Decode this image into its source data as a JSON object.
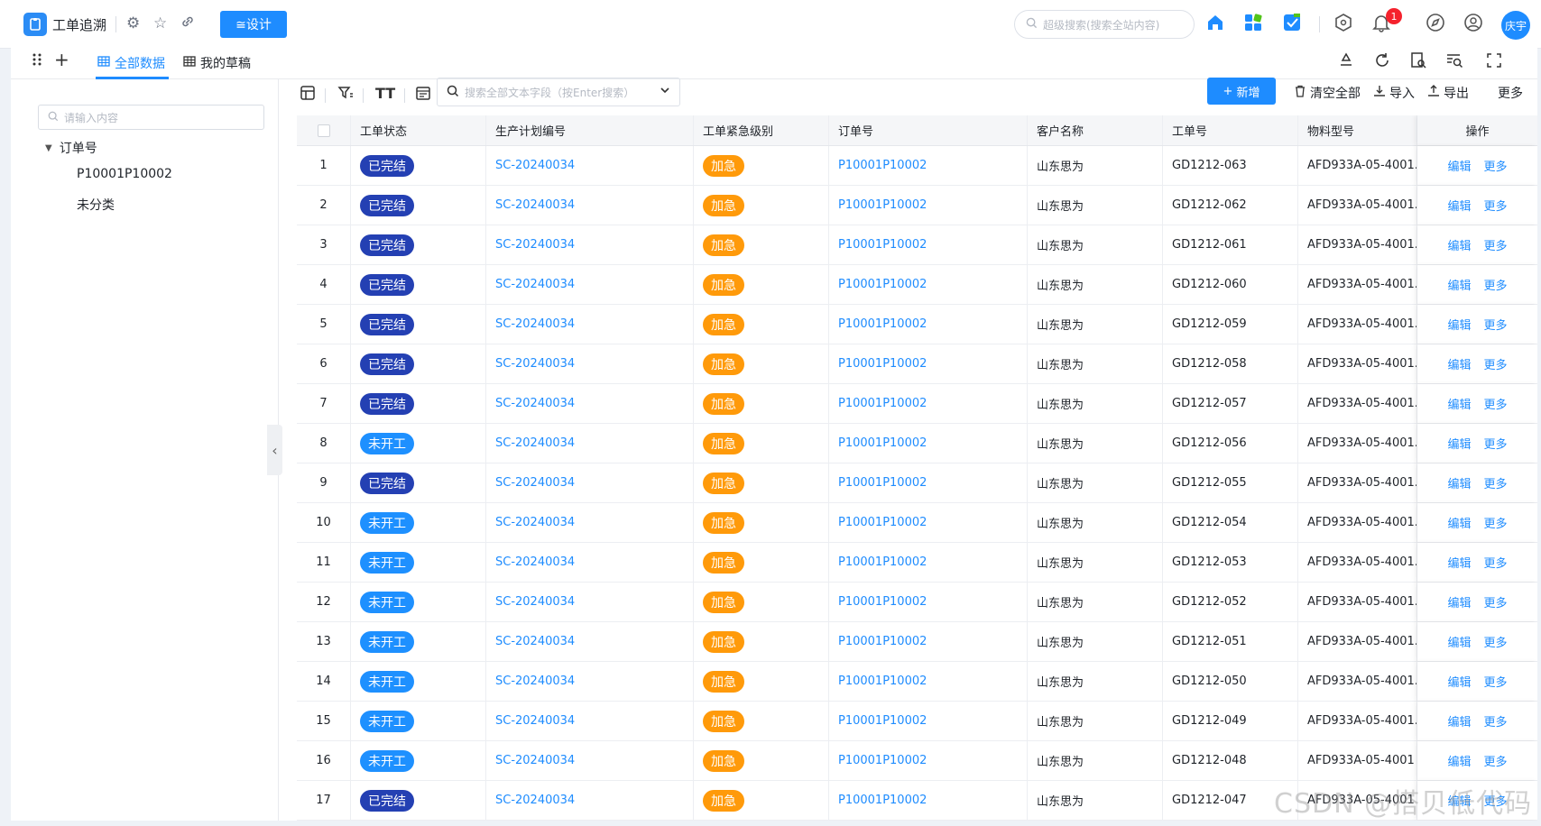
{
  "app": {
    "title": "工单追溯",
    "design_label": "≅设计",
    "global_search_placeholder": "超级搜索(搜索全站内容)",
    "notification_count": "1",
    "user_name": "庆宇"
  },
  "tabs": [
    {
      "label": "全部数据"
    },
    {
      "label": "我的草稿"
    }
  ],
  "sidebar": {
    "search_placeholder": "请输入内容",
    "tree_root": "订单号",
    "tree_children": [
      "P10001P10002",
      "未分类"
    ]
  },
  "toolbar": {
    "search_placeholder": "搜索全部文本字段（按Enter搜索）",
    "new_label": "新增",
    "clear_label": "清空全部",
    "import_label": "导入",
    "export_label": "导出",
    "more_label": "更多"
  },
  "table": {
    "columns": [
      "工单状态",
      "生产计划编号",
      "工单紧急级别",
      "订单号",
      "客户名称",
      "工单号",
      "物料型号",
      "操作"
    ],
    "actions": {
      "edit": "编辑",
      "more": "更多"
    },
    "rows": [
      {
        "no": "1",
        "status": "已完结",
        "plan": "SC-20240034",
        "urgency": "加急",
        "order": "P10001P10002",
        "customer": "山东思为",
        "wo": "GD1212-063",
        "material": "AFD933A-05-4001."
      },
      {
        "no": "2",
        "status": "已完结",
        "plan": "SC-20240034",
        "urgency": "加急",
        "order": "P10001P10002",
        "customer": "山东思为",
        "wo": "GD1212-062",
        "material": "AFD933A-05-4001."
      },
      {
        "no": "3",
        "status": "已完结",
        "plan": "SC-20240034",
        "urgency": "加急",
        "order": "P10001P10002",
        "customer": "山东思为",
        "wo": "GD1212-061",
        "material": "AFD933A-05-4001."
      },
      {
        "no": "4",
        "status": "已完结",
        "plan": "SC-20240034",
        "urgency": "加急",
        "order": "P10001P10002",
        "customer": "山东思为",
        "wo": "GD1212-060",
        "material": "AFD933A-05-4001."
      },
      {
        "no": "5",
        "status": "已完结",
        "plan": "SC-20240034",
        "urgency": "加急",
        "order": "P10001P10002",
        "customer": "山东思为",
        "wo": "GD1212-059",
        "material": "AFD933A-05-4001."
      },
      {
        "no": "6",
        "status": "已完结",
        "plan": "SC-20240034",
        "urgency": "加急",
        "order": "P10001P10002",
        "customer": "山东思为",
        "wo": "GD1212-058",
        "material": "AFD933A-05-4001."
      },
      {
        "no": "7",
        "status": "已完结",
        "plan": "SC-20240034",
        "urgency": "加急",
        "order": "P10001P10002",
        "customer": "山东思为",
        "wo": "GD1212-057",
        "material": "AFD933A-05-4001."
      },
      {
        "no": "8",
        "status": "未开工",
        "plan": "SC-20240034",
        "urgency": "加急",
        "order": "P10001P10002",
        "customer": "山东思为",
        "wo": "GD1212-056",
        "material": "AFD933A-05-4001."
      },
      {
        "no": "9",
        "status": "已完结",
        "plan": "SC-20240034",
        "urgency": "加急",
        "order": "P10001P10002",
        "customer": "山东思为",
        "wo": "GD1212-055",
        "material": "AFD933A-05-4001."
      },
      {
        "no": "10",
        "status": "未开工",
        "plan": "SC-20240034",
        "urgency": "加急",
        "order": "P10001P10002",
        "customer": "山东思为",
        "wo": "GD1212-054",
        "material": "AFD933A-05-4001."
      },
      {
        "no": "11",
        "status": "未开工",
        "plan": "SC-20240034",
        "urgency": "加急",
        "order": "P10001P10002",
        "customer": "山东思为",
        "wo": "GD1212-053",
        "material": "AFD933A-05-4001."
      },
      {
        "no": "12",
        "status": "未开工",
        "plan": "SC-20240034",
        "urgency": "加急",
        "order": "P10001P10002",
        "customer": "山东思为",
        "wo": "GD1212-052",
        "material": "AFD933A-05-4001."
      },
      {
        "no": "13",
        "status": "未开工",
        "plan": "SC-20240034",
        "urgency": "加急",
        "order": "P10001P10002",
        "customer": "山东思为",
        "wo": "GD1212-051",
        "material": "AFD933A-05-4001."
      },
      {
        "no": "14",
        "status": "未开工",
        "plan": "SC-20240034",
        "urgency": "加急",
        "order": "P10001P10002",
        "customer": "山东思为",
        "wo": "GD1212-050",
        "material": "AFD933A-05-4001."
      },
      {
        "no": "15",
        "status": "未开工",
        "plan": "SC-20240034",
        "urgency": "加急",
        "order": "P10001P10002",
        "customer": "山东思为",
        "wo": "GD1212-049",
        "material": "AFD933A-05-4001."
      },
      {
        "no": "16",
        "status": "未开工",
        "plan": "SC-20240034",
        "urgency": "加急",
        "order": "P10001P10002",
        "customer": "山东思为",
        "wo": "GD1212-048",
        "material": "AFD933A-05-4001"
      },
      {
        "no": "17",
        "status": "已完结",
        "plan": "SC-20240034",
        "urgency": "加急",
        "order": "P10001P10002",
        "customer": "山东思为",
        "wo": "GD1212-047",
        "material": "AFD933A-05-4001"
      }
    ]
  },
  "status_colors": {
    "已完结": "#2440b3",
    "未开工": "#1e90ff",
    "加急": "#ff9a0a"
  },
  "watermark": "CSDN @搭贝低代码"
}
